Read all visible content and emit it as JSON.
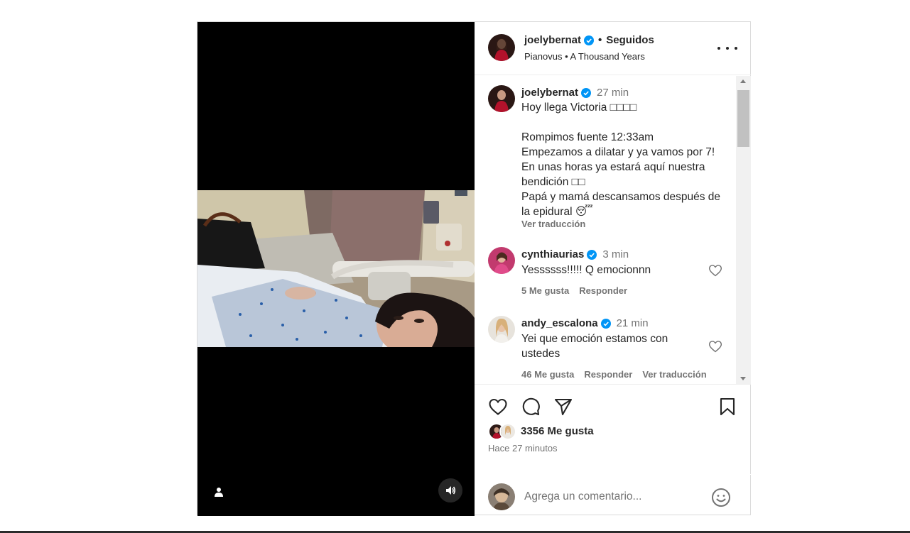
{
  "colors": {
    "accent_verified": "#0095f6",
    "text": "#262626",
    "muted": "#737373",
    "border": "#dbdbdb"
  },
  "header": {
    "username": "joelybernat",
    "separator": "•",
    "follow_state": "Seguidos",
    "audio": "Pianovus • A Thousand Years",
    "more_icon": "more-horizontal-icon"
  },
  "caption": {
    "username": "joelybernat",
    "time": "27 min",
    "text": "Hoy llega Victoria □□□□\n\nRompimos fuente 12:33am\nEmpezamos a dilatar y ya vamos por 7!\nEn unas horas ya estará aquí nuestra bendición □□\nPapá y mamá descansamos después de la epidural 😴",
    "translate": "Ver traducción"
  },
  "comments": [
    {
      "username": "cynthiaurias",
      "time": "3 min",
      "text": "Yessssss!!!!! Q emocionnn",
      "likes": "5 Me gusta",
      "reply": "Responder"
    },
    {
      "username": "andy_escalona",
      "time": "21 min",
      "text": "Yei que emoción estamos con ustedes",
      "likes": "46 Me gusta",
      "reply": "Responder",
      "translate": "Ver traducción"
    }
  ],
  "actions": {
    "icons": [
      "heart-icon",
      "comment-icon",
      "share-icon",
      "bookmark-icon"
    ],
    "likes": "3356 Me gusta",
    "time_ago": "Hace 27 minutos"
  },
  "add_comment": {
    "placeholder": "Agrega un comentario...",
    "emoji_icon": "emoji-icon"
  },
  "media": {
    "tag_icon": "user-tag-icon",
    "sound_icon": "volume-icon"
  }
}
